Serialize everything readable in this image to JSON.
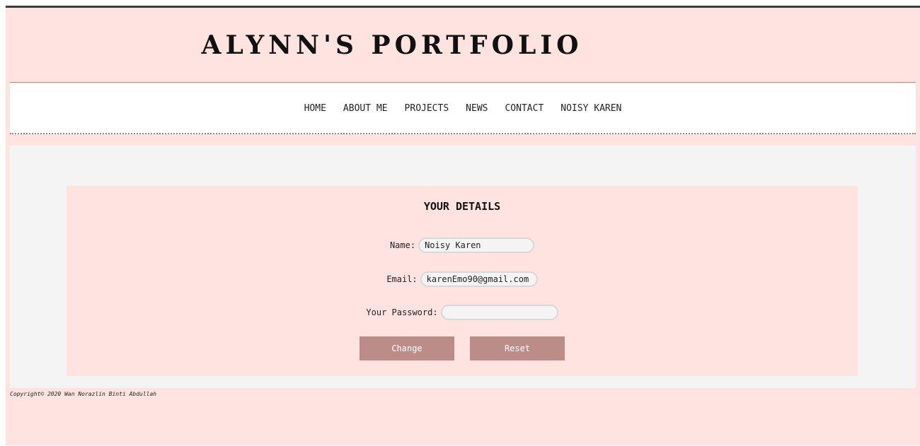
{
  "header": {
    "title": "ALYNN'S PORTFOLIO"
  },
  "nav": {
    "items": [
      {
        "label": "HOME"
      },
      {
        "label": "ABOUT ME"
      },
      {
        "label": "PROJECTS"
      },
      {
        "label": "NEWS"
      },
      {
        "label": "CONTACT"
      },
      {
        "label": "NOISY KAREN"
      }
    ]
  },
  "form": {
    "heading": "YOUR DETAILS",
    "name_label": "Name:",
    "name_value": "Noisy Karen",
    "email_label": "Email:",
    "email_value": "karenEmo90@gmail.com",
    "password_label": "Your Password:",
    "password_value": "",
    "change_label": "Change",
    "reset_label": "Reset"
  },
  "footer": {
    "copyright": "Copyright© 2020 Wan Norazlin Binti Abdullah"
  },
  "colors": {
    "page_background": "#ffe3e0",
    "content_background": "#f4f4f4",
    "button": "#bc8c89",
    "top_bar": "#3b3b3b"
  }
}
